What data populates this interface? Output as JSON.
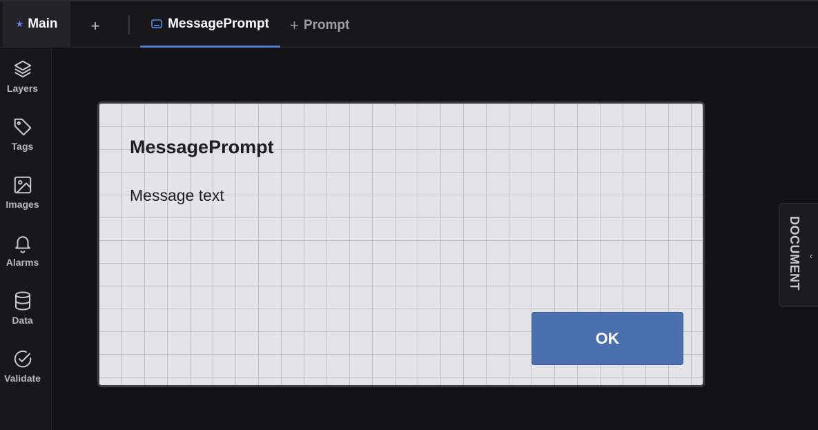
{
  "tabs": {
    "main_label": "Main",
    "add_symbol": "+",
    "active_label": "MessagePrompt",
    "new_prompt_plus": "+",
    "new_prompt_label": "Prompt"
  },
  "sidebar": {
    "items": [
      {
        "label": "Layers",
        "icon": "layers-icon"
      },
      {
        "label": "Tags",
        "icon": "tag-icon"
      },
      {
        "label": "Images",
        "icon": "image-icon"
      },
      {
        "label": "Alarms",
        "icon": "bell-icon"
      },
      {
        "label": "Data",
        "icon": "database-icon"
      },
      {
        "label": "Validate",
        "icon": "check-circle-icon"
      }
    ]
  },
  "dialog": {
    "title": "MessagePrompt",
    "message": "Message text",
    "ok_label": "OK"
  },
  "right_panel": {
    "label": "DOCUMENT",
    "chevron": "‹"
  },
  "colors": {
    "accent": "#4e79d4",
    "ok_button": "#4a70b0",
    "background": "#121214"
  }
}
